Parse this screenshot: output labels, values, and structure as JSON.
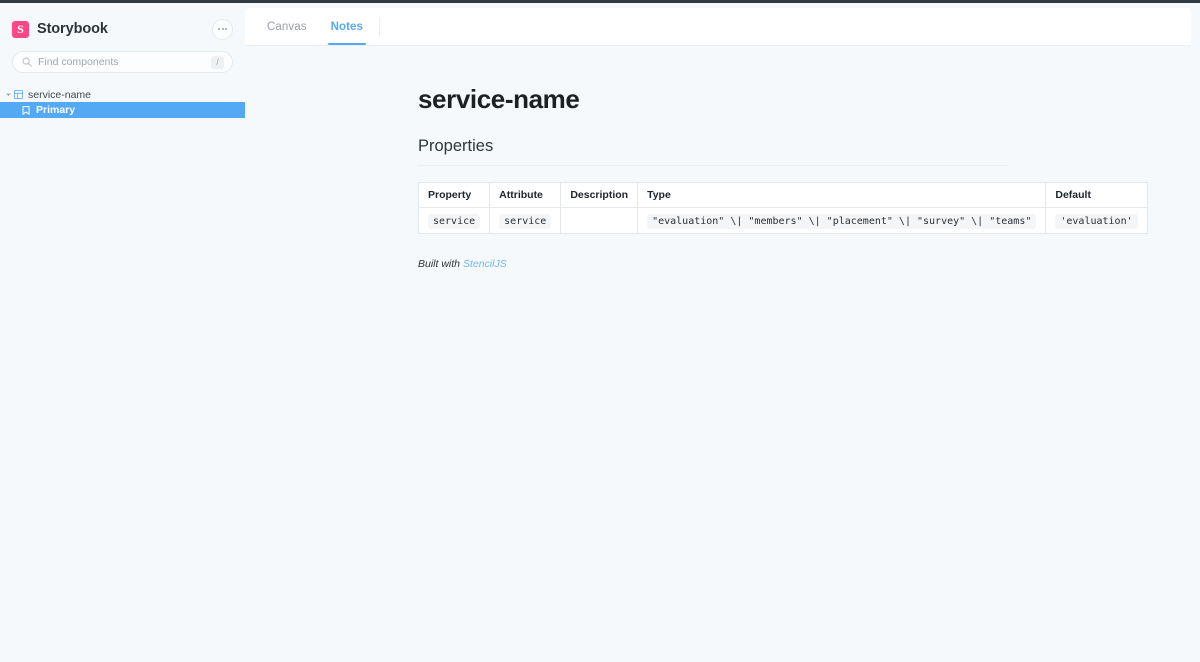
{
  "sidebar": {
    "brand": {
      "logo_letter": "S",
      "name": "Storybook"
    },
    "menu_button_label": "•••",
    "search": {
      "placeholder": "Find components",
      "value": "",
      "shortcut": "/"
    },
    "tree": [
      {
        "label": "service-name",
        "type": "component",
        "icon": "component-grid-icon",
        "expanded": true,
        "selected": false
      },
      {
        "label": "Primary",
        "type": "story",
        "icon": "bookmark-icon",
        "selected": true
      }
    ]
  },
  "panel": {
    "tabs": [
      {
        "label": "Canvas",
        "active": false
      },
      {
        "label": "Notes",
        "active": true
      }
    ],
    "notes": {
      "title": "service-name",
      "section_heading": "Properties",
      "table": {
        "columns": [
          "Property",
          "Attribute",
          "Description",
          "Type",
          "Default"
        ],
        "rows": [
          {
            "property": "service",
            "attribute": "service",
            "description": "",
            "type": "\"evaluation\" \\| \"members\" \\| \"placement\" \\| \"survey\" \\| \"teams\"",
            "default": "'evaluation'"
          }
        ]
      },
      "footer": {
        "text": "Built with ",
        "link_label": "StencilJS"
      }
    }
  },
  "colors": {
    "accent_blue": "#54a8f4",
    "selected_row_blue": "#53a9f4",
    "brand_pink": "#ff4785",
    "app_background": "#f6f9fc",
    "panel_white": "#ffffff",
    "link_blue": "#71b6f5"
  }
}
